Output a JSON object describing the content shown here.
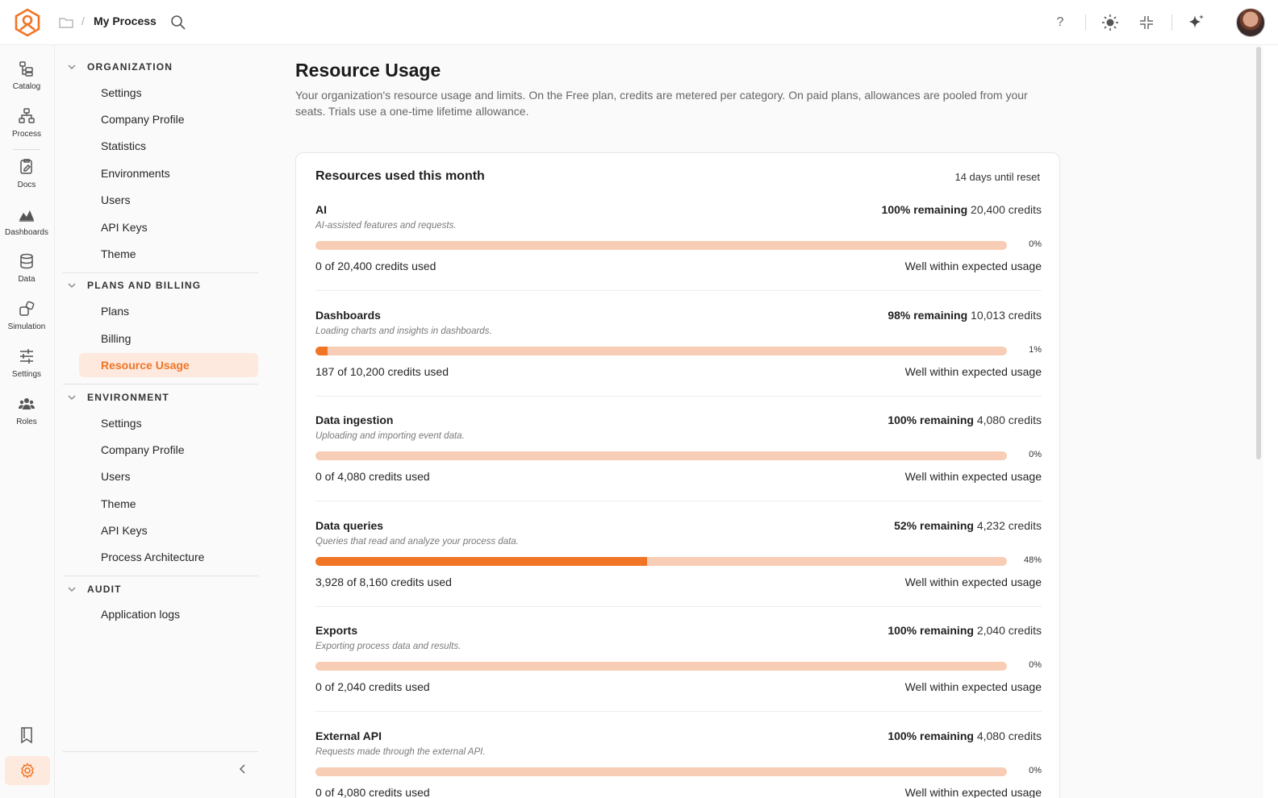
{
  "topbar": {
    "breadcrumb_sep": "/",
    "title": "My Process"
  },
  "rail": [
    {
      "label": "Catalog",
      "icon": "catalog-icon"
    },
    {
      "label": "Process",
      "icon": "process-icon"
    },
    {
      "label": "Docs",
      "icon": "docs-icon"
    },
    {
      "label": "Dashboards",
      "icon": "dashboards-icon"
    },
    {
      "label": "Data",
      "icon": "database-icon"
    },
    {
      "label": "Simulation",
      "icon": "simulation-icon"
    },
    {
      "label": "Settings",
      "icon": "sliders-icon"
    },
    {
      "label": "Roles",
      "icon": "users-icon"
    }
  ],
  "nav": {
    "organization": {
      "title": "ORGANIZATION",
      "items": [
        "Settings",
        "Company Profile",
        "Statistics",
        "Environments",
        "Users",
        "API Keys",
        "Theme"
      ]
    },
    "plans": {
      "title": "PLANS AND BILLING",
      "items": [
        "Plans",
        "Billing",
        "Resource Usage"
      ],
      "active": "Resource Usage"
    },
    "environment": {
      "title": "ENVIRONMENT",
      "items": [
        "Settings",
        "Company Profile",
        "Users",
        "Theme",
        "API Keys",
        "Process Architecture"
      ]
    },
    "audit": {
      "title": "AUDIT",
      "items": [
        "Application logs"
      ]
    }
  },
  "page": {
    "title": "Resource Usage",
    "description": "Your organization's resource usage and limits. On the Free plan, credits are metered per category. On paid plans, allowances are pooled from your seats. Trials use a one-time lifetime allowance."
  },
  "card": {
    "title": "Resources used this month",
    "reset": "14 days until reset",
    "resources": [
      {
        "name": "AI",
        "desc": "AI-assisted features and requests.",
        "remaining_pct": "100% remaining",
        "remaining_credits": "20,400 credits",
        "used_fraction": 0.0,
        "pct_label": "0%",
        "used": "0 of 20,400 credits used",
        "status": "Well within expected usage"
      },
      {
        "name": "Dashboards",
        "desc": "Loading charts and insights in dashboards.",
        "remaining_pct": "98% remaining",
        "remaining_credits": "10,013 credits",
        "used_fraction": 0.018,
        "pct_label": "1%",
        "used": "187 of 10,200 credits used",
        "status": "Well within expected usage"
      },
      {
        "name": "Data ingestion",
        "desc": "Uploading and importing event data.",
        "remaining_pct": "100% remaining",
        "remaining_credits": "4,080 credits",
        "used_fraction": 0.0,
        "pct_label": "0%",
        "used": "0 of 4,080 credits used",
        "status": "Well within expected usage"
      },
      {
        "name": "Data queries",
        "desc": "Queries that read and analyze your process data.",
        "remaining_pct": "52% remaining",
        "remaining_credits": "4,232 credits",
        "used_fraction": 0.48,
        "pct_label": "48%",
        "used": "3,928 of 8,160 credits used",
        "status": "Well within expected usage"
      },
      {
        "name": "Exports",
        "desc": "Exporting process data and results.",
        "remaining_pct": "100% remaining",
        "remaining_credits": "2,040 credits",
        "used_fraction": 0.0,
        "pct_label": "0%",
        "used": "0 of 2,040 credits used",
        "status": "Well within expected usage"
      },
      {
        "name": "External API",
        "desc": "Requests made through the external API.",
        "remaining_pct": "100% remaining",
        "remaining_credits": "4,080 credits",
        "used_fraction": 0.0,
        "pct_label": "0%",
        "used": "0 of 4,080 credits used",
        "status": "Well within expected usage"
      }
    ]
  },
  "colors": {
    "accent": "#f07525",
    "accent_light": "#f8cdb5",
    "active_bg": "#fde9de"
  }
}
